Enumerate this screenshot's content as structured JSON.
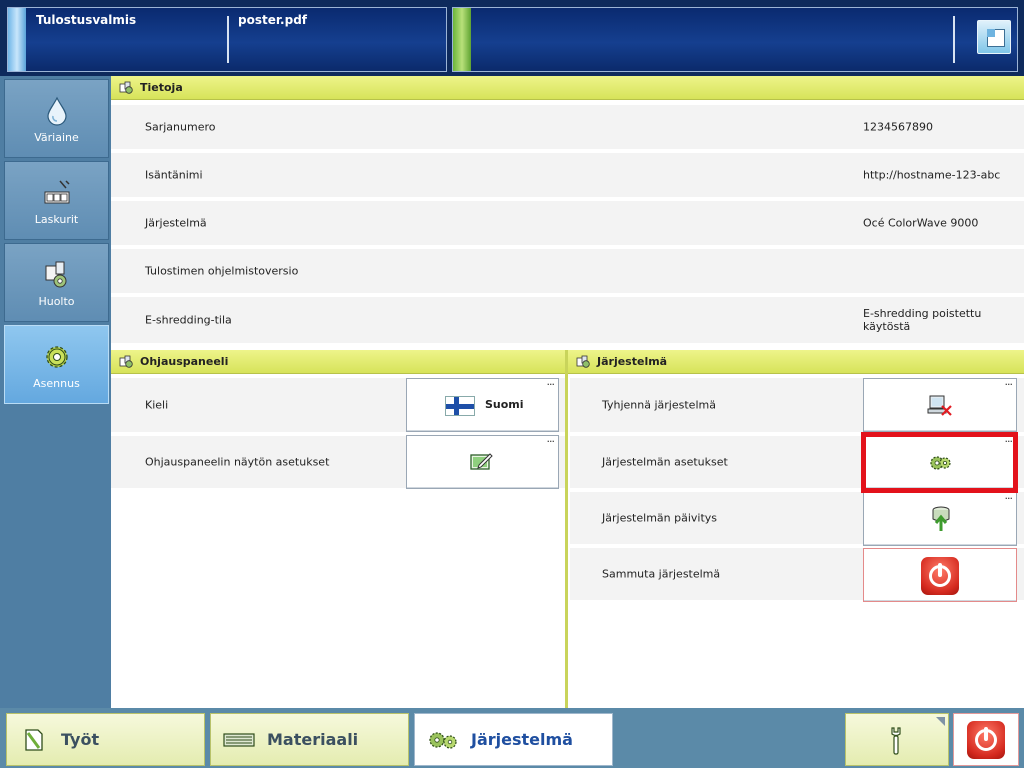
{
  "header": {
    "status": "Tulostusvalmis",
    "job_file": "poster.pdf"
  },
  "nav": {
    "items": [
      {
        "label": "Väriaine",
        "icon": "ink-drop-icon"
      },
      {
        "label": "Laskurit",
        "icon": "counter-icon"
      },
      {
        "label": "Huolto",
        "icon": "maintenance-icon"
      },
      {
        "label": "Asennus",
        "icon": "gear-icon",
        "active": true
      }
    ]
  },
  "info": {
    "title": "Tietoja",
    "rows": [
      {
        "label": "Sarjanumero",
        "value": "1234567890"
      },
      {
        "label": "Isäntänimi",
        "value": "http://hostname-123-abc"
      },
      {
        "label": "Järjestelmä",
        "value": "Océ ColorWave 9000"
      },
      {
        "label": "Tulostimen ohjelmistoversio",
        "value": ""
      },
      {
        "label": "E-shredding-tila",
        "value": "E-shredding poistettu käytöstä"
      }
    ]
  },
  "panel": {
    "title": "Ohjauspaneeli",
    "language_label": "Kieli",
    "language_value": "Suomi",
    "display_label": "Ohjauspaneelin näytön asetukset"
  },
  "system": {
    "title": "Järjestelmä",
    "clear_label": "Tyhjennä järjestelmä",
    "settings_label": "Järjestelmän asetukset",
    "update_label": "Järjestelmän päivitys",
    "shutdown_label": "Sammuta järjestelmä"
  },
  "bottom": {
    "jobs": "Työt",
    "media": "Materiaali",
    "system": "Järjestelmä"
  },
  "colors": {
    "section_bar": "#d7e35a",
    "highlight": "#e3121b",
    "active_tab_text": "#1f4fa0"
  }
}
